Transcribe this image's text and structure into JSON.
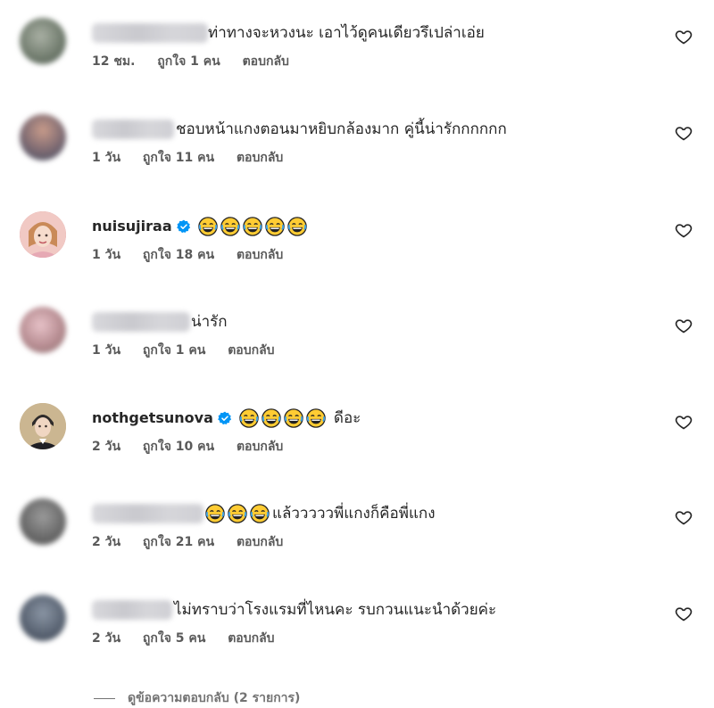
{
  "comments": [
    {
      "username": "",
      "verified": false,
      "text": "ท่าทางจะหวงนะ เอาไว้ดูคนเดียวรึเปล่าเอ่ย",
      "emoji_count": 0,
      "time": "12 ชม.",
      "likes": "ถูกใจ 1 คน",
      "reply": "ตอบกลับ"
    },
    {
      "username": "",
      "verified": false,
      "text": "ชอบหน้าแกงตอนมาหยิบกล้องมาก คู่นี้น่ารักกกกกก",
      "emoji_count": 0,
      "time": "1 วัน",
      "likes": "ถูกใจ 11 คน",
      "reply": "ตอบกลับ"
    },
    {
      "username": "nuisujiraa",
      "verified": true,
      "text": "",
      "emoji_count": 5,
      "time": "1 วัน",
      "likes": "ถูกใจ 18 คน",
      "reply": "ตอบกลับ"
    },
    {
      "username": "",
      "verified": false,
      "text": "น่ารัก",
      "emoji_count": 0,
      "time": "1 วัน",
      "likes": "ถูกใจ 1 คน",
      "reply": "ตอบกลับ"
    },
    {
      "username": "nothgetsunova",
      "verified": true,
      "text": "ดีอะ",
      "emoji_count": 4,
      "time": "2 วัน",
      "likes": "ถูกใจ 10 คน",
      "reply": "ตอบกลับ"
    },
    {
      "username": "",
      "verified": false,
      "text": "แล้วววววพี่แกงก็คือพี่แกง",
      "emoji_count": 3,
      "time": "2 วัน",
      "likes": "ถูกใจ 21 คน",
      "reply": "ตอบกลับ"
    },
    {
      "username": "",
      "verified": false,
      "text": "ไม่ทราบว่าโรงแรมที่ไหนคะ รบกวนแนะนำด้วยค่ะ",
      "emoji_count": 0,
      "time": "2 วัน",
      "likes": "ถูกใจ 5 คน",
      "reply": "ตอบกลับ"
    }
  ],
  "view_replies": "ดูข้อความตอบกลับ (2 รายการ)",
  "icons": {
    "heart": "heart-icon",
    "verified": "verified-badge-icon",
    "emoji": "face-with-tears-of-joy-icon"
  },
  "colors": {
    "text": "#262626",
    "meta": "#5a5a5a",
    "verified": "#0095f6",
    "emoji_face": "#ffcc33"
  }
}
